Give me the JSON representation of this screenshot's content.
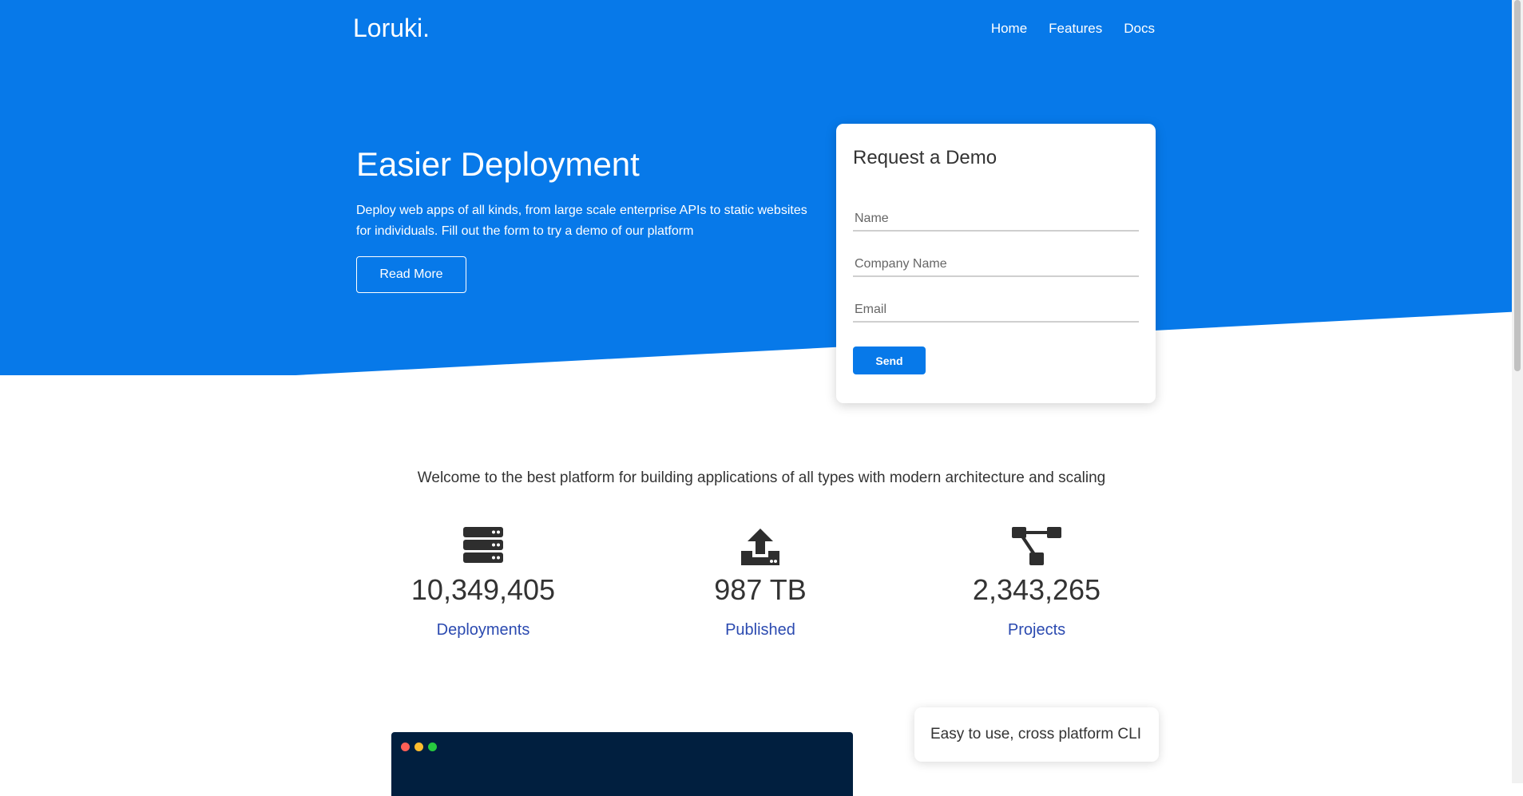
{
  "brand": {
    "logo": "Loruki."
  },
  "nav": {
    "items": [
      "Home",
      "Features",
      "Docs"
    ]
  },
  "hero": {
    "title": "Easier Deployment",
    "text": "Deploy web apps of all kinds, from large scale enterprise APIs to static websites for individuals. Fill out the form to try a demo of our platform",
    "button": "Read More"
  },
  "demo_form": {
    "title": "Request a Demo",
    "name_placeholder": "Name",
    "company_placeholder": "Company Name",
    "email_placeholder": "Email",
    "send_label": "Send"
  },
  "welcome": "Welcome to the best platform for building applications of all types with modern architecture and scaling",
  "stats": [
    {
      "icon": "server-icon",
      "value": "10,349,405",
      "label": "Deployments"
    },
    {
      "icon": "upload-icon",
      "value": "987 TB",
      "label": "Published"
    },
    {
      "icon": "project-diagram-icon",
      "value": "2,343,265",
      "label": "Projects"
    }
  ],
  "cli": {
    "text": "Easy to use, cross platform CLI"
  },
  "colors": {
    "primary": "#0779e9",
    "accent_text": "#2b4ab0",
    "terminal": "#011f3f"
  }
}
